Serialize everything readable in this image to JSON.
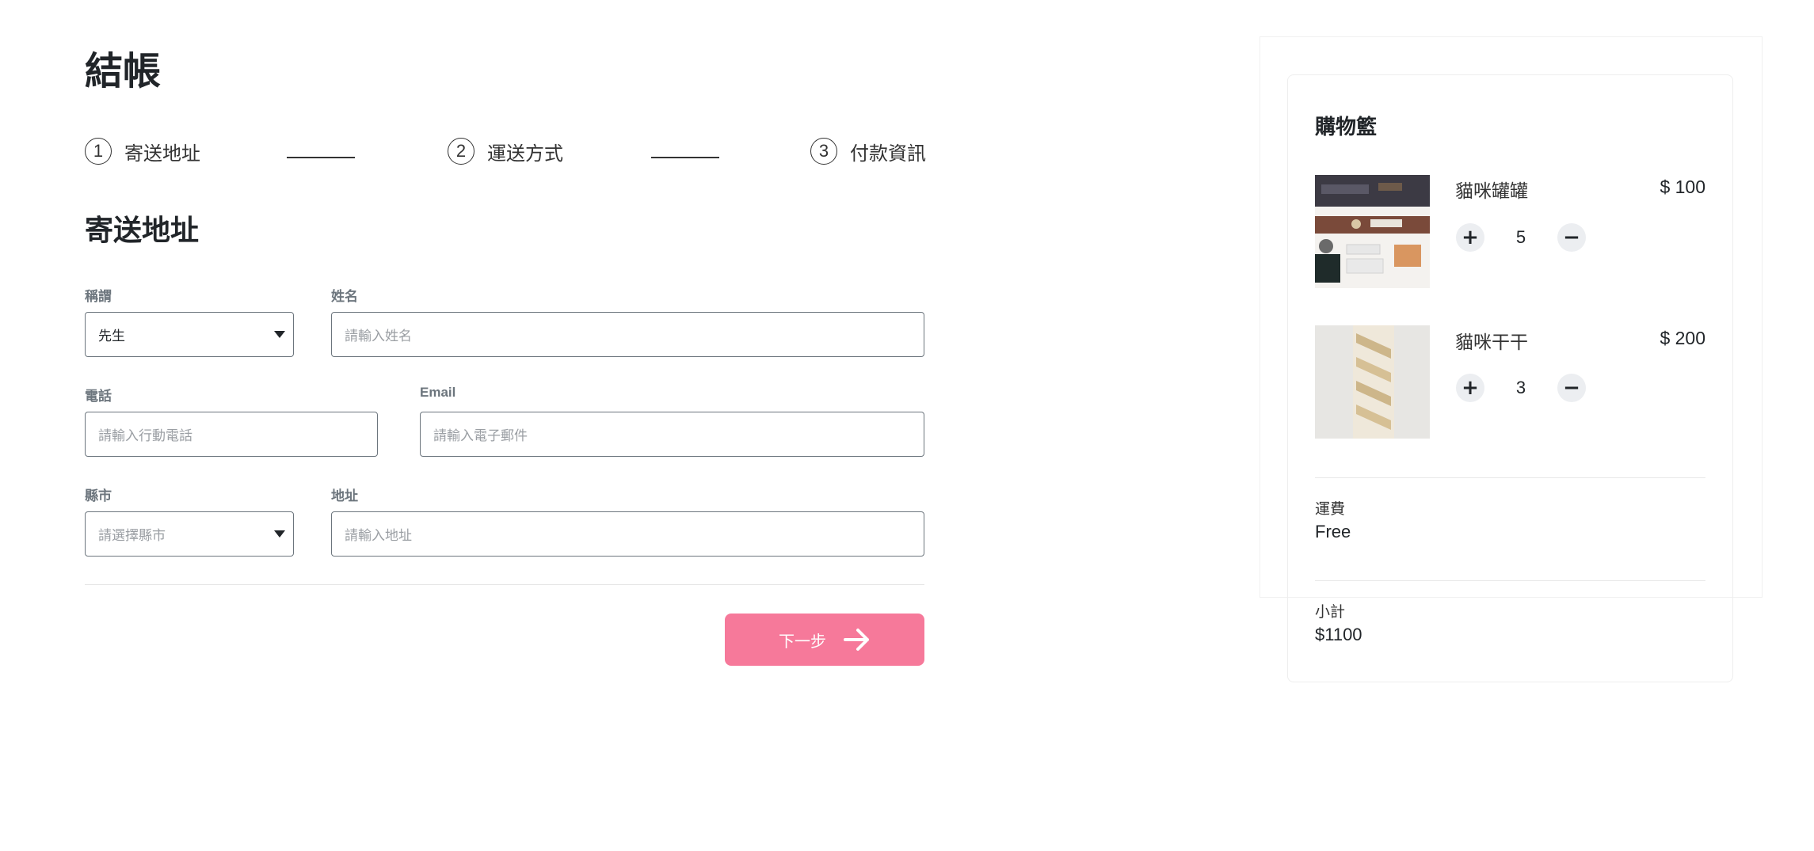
{
  "page": {
    "title": "結帳",
    "section_title": "寄送地址"
  },
  "steps": [
    {
      "number": "1",
      "label": "寄送地址"
    },
    {
      "number": "2",
      "label": "運送方式"
    },
    {
      "number": "3",
      "label": "付款資訊"
    }
  ],
  "form": {
    "title": {
      "label": "稱謂",
      "value": "先生"
    },
    "name": {
      "label": "姓名",
      "placeholder": "請輸入姓名"
    },
    "phone": {
      "label": "電話",
      "placeholder": "請輸入行動電話"
    },
    "email": {
      "label": "Email",
      "placeholder": "請輸入電子郵件"
    },
    "city": {
      "label": "縣市",
      "placeholder": "請選擇縣市"
    },
    "address": {
      "label": "地址",
      "placeholder": "請輸入地址"
    },
    "next_label": "下一步"
  },
  "cart": {
    "title": "購物籃",
    "items": [
      {
        "name": "貓咪罐罐",
        "price": "$ 100",
        "qty": "5",
        "image": "desk-photo"
      },
      {
        "name": "貓咪干干",
        "price": "$ 200",
        "qty": "3",
        "image": "stairs-photo"
      }
    ],
    "shipping_label": "運費",
    "shipping_value": "Free",
    "subtotal_label": "小計",
    "subtotal_value": "$1100"
  },
  "colors": {
    "accent": "#f6799a",
    "text": "#212529",
    "muted": "#6c757d"
  }
}
